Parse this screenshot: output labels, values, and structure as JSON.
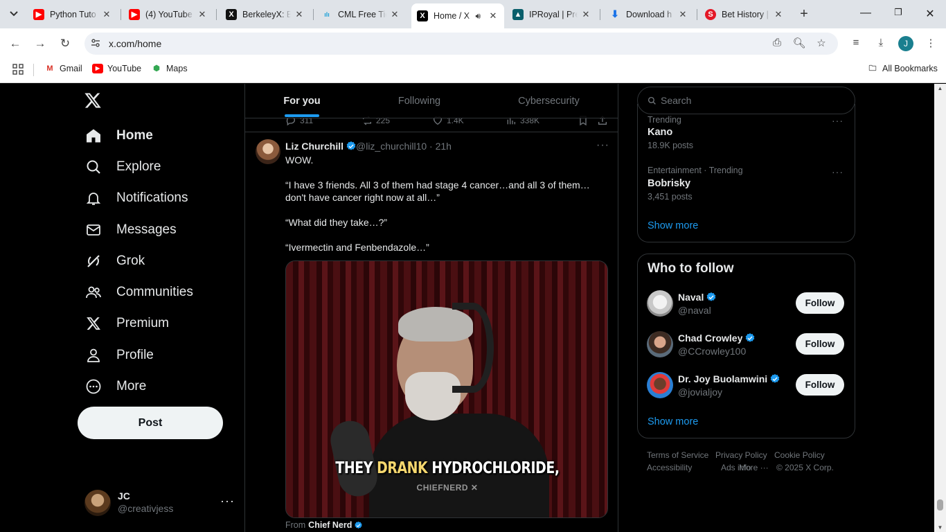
{
  "browser": {
    "tabs": [
      {
        "title": "Python Tuto",
        "favicon": "youtube-favicon",
        "color": "#ff0000"
      },
      {
        "title": "(4) YouTube",
        "favicon": "youtube-favicon",
        "color": "#ff0000"
      },
      {
        "title": "BerkeleyX: Bl",
        "favicon": "edx-favicon",
        "color": "#111111"
      },
      {
        "title": "CML Free Tie",
        "favicon": "cisco-favicon",
        "color": "#1ba0d7"
      },
      {
        "title": "Home / X",
        "favicon": "x-favicon",
        "color": "#000000"
      },
      {
        "title": "IPRoyal | Pre",
        "favicon": "iproyal-favicon",
        "color": "#0a5f6b"
      },
      {
        "title": "Download h",
        "favicon": "download-favicon",
        "color": "#1a73e8"
      },
      {
        "title": "Bet History |",
        "favicon": "sportybet-favicon",
        "color": "#e41827"
      }
    ],
    "url": "x.com/home",
    "profile_initial": "J",
    "bookmarks": [
      {
        "label": "Gmail"
      },
      {
        "label": "YouTube"
      },
      {
        "label": "Maps"
      }
    ],
    "all_bookmarks": "All Bookmarks"
  },
  "nav": {
    "items": [
      {
        "label": "Home",
        "icon": "home-icon"
      },
      {
        "label": "Explore",
        "icon": "search-icon"
      },
      {
        "label": "Notifications",
        "icon": "bell-icon"
      },
      {
        "label": "Messages",
        "icon": "envelope-icon"
      },
      {
        "label": "Grok",
        "icon": "grok-icon"
      },
      {
        "label": "Communities",
        "icon": "people-icon"
      },
      {
        "label": "Premium",
        "icon": "x-icon"
      },
      {
        "label": "Profile",
        "icon": "person-icon"
      },
      {
        "label": "More",
        "icon": "more-circle-icon"
      }
    ],
    "post_label": "Post",
    "account": {
      "name": "JC",
      "handle": "@creativjess"
    }
  },
  "feed": {
    "tabs": [
      "For you",
      "Following",
      "Cybersecurity"
    ],
    "prev_post_stats": {
      "replies": "311",
      "reposts": "225",
      "likes": "1.4K",
      "views": "338K"
    },
    "post": {
      "author": "Liz Churchill",
      "handle": "@liz_churchill10",
      "time": "· 21h",
      "lines": [
        "WOW.",
        "“I have 3 friends. All 3 of them had stage 4 cancer…and all 3 of them…don't have cancer right now at all…”",
        "“What did they take…?”",
        "“Ivermectin and Fenbendazole…”"
      ],
      "video_caption_pre": "THEY ",
      "video_caption_highlight": "DRANK",
      "video_caption_post": " HYDROCHLORIDE,",
      "video_watermark": "CHIEFNERD",
      "from_label": "From",
      "from_source": "Chief Nerd"
    }
  },
  "sidebar": {
    "search_placeholder": "Search",
    "trends": [
      {
        "meta": "Trending",
        "name": "Kano",
        "count": "18.9K posts"
      },
      {
        "meta": "Entertainment · Trending",
        "name": "Bobrisky",
        "count": "3,451 posts"
      }
    ],
    "trends_show_more": "Show more",
    "who_to_follow_title": "Who to follow",
    "suggestions": [
      {
        "name": "Naval",
        "handle": "@naval",
        "button": "Follow"
      },
      {
        "name": "Chad Crowley",
        "handle": "@CCrowley100",
        "button": "Follow"
      },
      {
        "name": "Dr. Joy Buolamwini",
        "handle": "@jovialjoy",
        "button": "Follow"
      }
    ],
    "wtf_show_more": "Show more",
    "footer": {
      "row1": [
        "Terms of Service",
        "Privacy Policy",
        "Cookie Policy"
      ],
      "row2": [
        "Accessibility",
        "Ads info",
        "More ···",
        "© 2025 X Corp."
      ]
    }
  },
  "colors": {
    "accent": "#1d9bf0",
    "background": "#000000",
    "border": "#2f3336",
    "muted": "#71767b"
  }
}
